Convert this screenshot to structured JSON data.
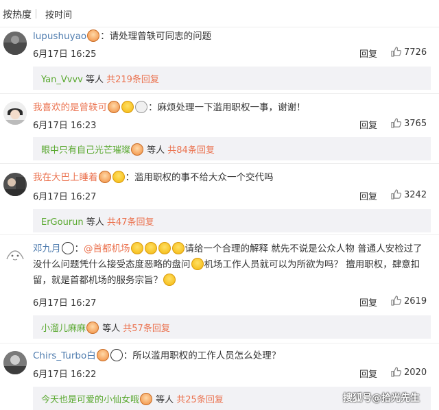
{
  "sort_bar": {
    "hot_label": "按热度",
    "time_label": "按时间"
  },
  "comments": [
    {
      "username": "lupushuyao",
      "text": "：请处理曾轶可同志的问题",
      "time": "6月17日 16:25",
      "reply_label": "回复",
      "likes": "7726",
      "sub_user": "Yan_Vvvv",
      "sub_suffix": " 等人 ",
      "sub_count": "共219条回复"
    },
    {
      "username": "我喜欢的是曾轶可",
      "text": "：麻烦处理一下滥用职权一事，谢谢！",
      "time": "6月17日 16:23",
      "reply_label": "回复",
      "likes": "3765",
      "sub_user": "眼中只有自己光芒璀璨",
      "sub_suffix": " 等人 ",
      "sub_count": "共84条回复"
    },
    {
      "username": "我在大巴上睡着",
      "text": "：滥用职权的事不给大众一个交代吗",
      "time": "6月17日 16:27",
      "reply_label": "回复",
      "likes": "3242",
      "sub_user": "ErGourun",
      "sub_suffix": " 等人 ",
      "sub_count": "共47条回复"
    },
    {
      "username": "邓九月",
      "mention": "@首都机场",
      "text_a": "请给一个合理的解释 就先不说是公众人物 普通人安检过了没什么问题凭什么接受态度恶略的盘问",
      "text_b": "机场工作人员就可以为所欲为吗？ 擅用职权，肆意扣留，就是首都机场的服务宗旨？",
      "time": "6月17日 16:27",
      "reply_label": "回复",
      "likes": "2619",
      "sub_user": "小溜儿麻麻",
      "sub_suffix": " 等人 ",
      "sub_count": "共57条回复"
    },
    {
      "username": "Chirs_Turbo白",
      "text": "：所以滥用职权的工作人员怎么处理？",
      "time": "6月17日 16:22",
      "reply_label": "回复",
      "likes": "2020",
      "sub_user": "今天也是可爱的小仙女哦",
      "sub_suffix": " 等人 ",
      "sub_count": "共25条回复"
    }
  ],
  "watermark": "搜狐号@拾光先生"
}
